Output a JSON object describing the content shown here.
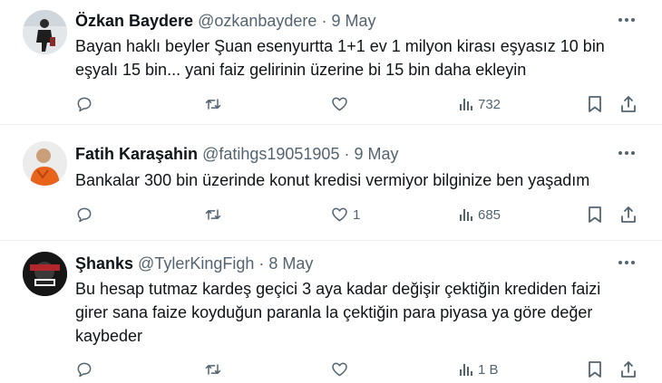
{
  "colors": {
    "text": "#0f1419",
    "muted": "#536471",
    "divider": "#eff3f4"
  },
  "tweets": [
    {
      "name": "Özkan Baydere",
      "handle": "@ozkanbaydere",
      "separator": "·",
      "date": "9 May",
      "text_lines": [
        "Bayan haklı beyler Şuan esenyurtta 1+1 ev 1 milyon kirası eşyasız 10 bin",
        "eşyalı 15 bin... yani faiz gelirinin üzerine bi 15 bin daha ekleyin"
      ],
      "likes": "",
      "views": "732",
      "icons": [
        "reply-icon",
        "retweet-icon",
        "like-icon",
        "views-icon",
        "bookmark-icon",
        "share-icon"
      ]
    },
    {
      "name": "Fatih Karaşahin",
      "handle": "@fatihgs19051905",
      "separator": "·",
      "date": "9 May",
      "text_lines": [
        "Bankalar 300 bin üzerinde konut kredisi vermiyor bilginize ben yaşadım"
      ],
      "likes": "1",
      "views": "685",
      "icons": [
        "reply-icon",
        "retweet-icon",
        "like-icon",
        "views-icon",
        "bookmark-icon",
        "share-icon"
      ]
    },
    {
      "name": "Şhanks",
      "handle": "@TylerKingFigh",
      "separator": "·",
      "date": "8 May",
      "text_lines": [
        "Bu hesap tutmaz kardeş geçici 3 aya kadar değişir çektiğin krediden faizi",
        "girer sana faize koyduğun paranla la çektiğin para piyasa ya göre değer",
        "kaybeder"
      ],
      "likes": "",
      "views": "1 B",
      "icons": [
        "reply-icon",
        "retweet-icon",
        "like-icon",
        "views-icon",
        "bookmark-icon",
        "share-icon"
      ]
    }
  ]
}
